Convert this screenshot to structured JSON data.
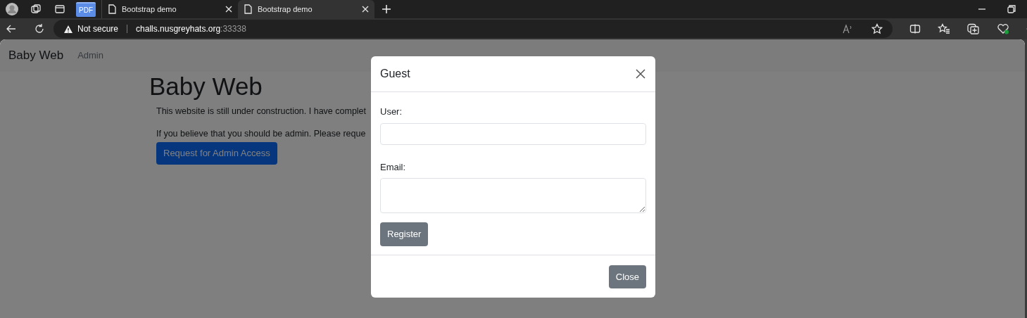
{
  "browser": {
    "pdf_label": "PDF",
    "tabs": [
      {
        "title": "Bootstrap demo",
        "selected": false
      },
      {
        "title": "Bootstrap demo",
        "selected": true
      }
    ],
    "security": "Not secure",
    "url_host": "challs.nusgreyhats.org",
    "url_port": ":33338"
  },
  "navbar": {
    "brand": "Baby Web",
    "links": [
      "Admin"
    ]
  },
  "page": {
    "heading": "Baby Web",
    "paragraphs": [
      "This website is still under construction. I have complet",
      "If you believe that you should be admin. Please reque"
    ],
    "button": "Request for Admin Access"
  },
  "modal": {
    "title": "Guest",
    "fields": [
      {
        "label": "User:",
        "kind": "input"
      },
      {
        "label": "Email:",
        "kind": "textarea"
      }
    ],
    "submit": "Register",
    "close": "Close"
  }
}
